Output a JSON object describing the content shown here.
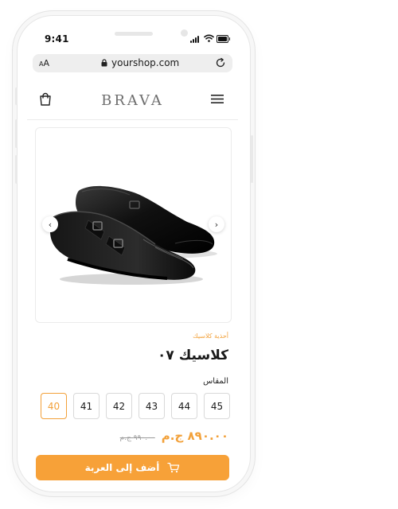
{
  "status": {
    "time": "9:41"
  },
  "browser": {
    "text_size": "AA",
    "url": "yourshop.com"
  },
  "header": {
    "logo": "BRAVA"
  },
  "product": {
    "category": "أحذية كلاسيك",
    "title": "كلاسيك ٠٧",
    "size_label": "المقاس",
    "sizes": [
      "45",
      "44",
      "43",
      "42",
      "41",
      "40"
    ],
    "selected_size": "40",
    "price": "٨٩٠.٠٠ ج.م",
    "old_price": "٩٩٠.٠٠ ج.م"
  },
  "actions": {
    "add_to_cart": "أضف إلى العربة"
  },
  "colors": {
    "accent": "#f7a138",
    "accent_text": "#f2a13a"
  },
  "icons": [
    "cart-icon",
    "menu-icon",
    "lock-icon",
    "reload-icon",
    "chevron-left-icon",
    "chevron-right-icon",
    "signal-icon",
    "wifi-icon",
    "battery-icon"
  ]
}
